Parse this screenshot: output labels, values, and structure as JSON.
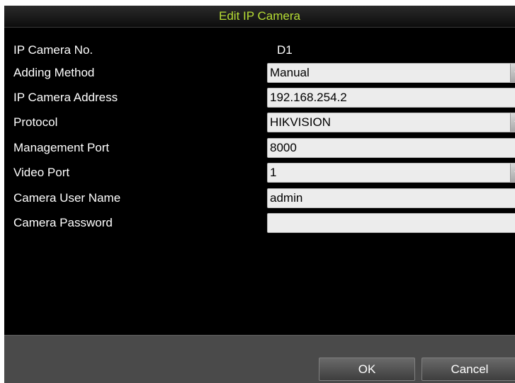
{
  "dialog": {
    "title": "Edit IP Camera"
  },
  "form": {
    "camera_no": {
      "label": "IP Camera No.",
      "value": "D1"
    },
    "adding_method": {
      "label": "Adding Method",
      "value": "Manual"
    },
    "ip_address": {
      "label": "IP Camera Address",
      "value": "192.168.254.2"
    },
    "protocol": {
      "label": "Protocol",
      "value": "HIKVISION"
    },
    "management_port": {
      "label": "Management Port",
      "value": "8000"
    },
    "video_port": {
      "label": "Video Port",
      "value": "1"
    },
    "user_name": {
      "label": "Camera User Name",
      "value": "admin"
    },
    "password": {
      "label": "Camera Password",
      "value": ""
    }
  },
  "buttons": {
    "ok": "OK",
    "cancel": "Cancel"
  },
  "colors": {
    "title_text": "#b6dd34",
    "background": "#000000",
    "footer": "#4a4a4a",
    "field_bg": "#ececec"
  }
}
